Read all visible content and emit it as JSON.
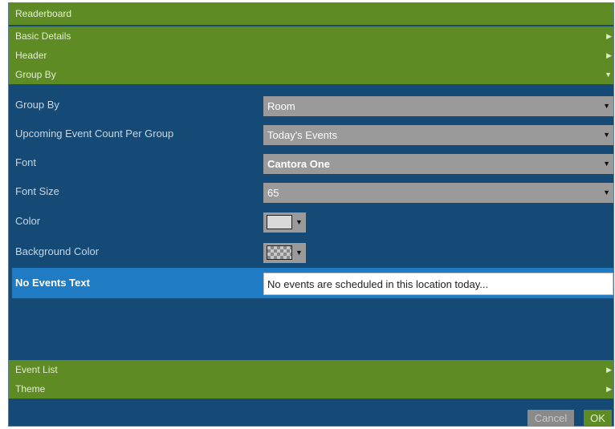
{
  "dialog": {
    "title": "Readerboard",
    "sections": [
      {
        "label": "Basic Details",
        "arrow": "▶"
      },
      {
        "label": "Header",
        "arrow": "▶"
      },
      {
        "label": "Group By",
        "arrow": "▼"
      }
    ],
    "bottom_sections": [
      {
        "label": "Event List",
        "arrow": "▶"
      },
      {
        "label": "Theme",
        "arrow": "▶"
      }
    ]
  },
  "group_by": {
    "rows": [
      {
        "label": "Group By",
        "value": "Room"
      },
      {
        "label": "Upcoming Event Count Per Group",
        "value": "Today's Events"
      },
      {
        "label": "Font",
        "value": "Cantora One"
      },
      {
        "label": "Font Size",
        "value": "65"
      }
    ],
    "caret": "▼",
    "color": {
      "label": "Color",
      "swatch": "#d9d9d9"
    },
    "background_color": {
      "label": "Background Color",
      "swatch": "transparent"
    },
    "no_events": {
      "label": "No Events Text",
      "value": "No events are scheduled in this location today..."
    }
  },
  "footer": {
    "cancel": "Cancel",
    "ok": "OK"
  },
  "colors": {
    "panel": "#154a76",
    "section": "#5f8b24",
    "selected_row": "#1f7cc4",
    "ok": "#5f8b24"
  }
}
